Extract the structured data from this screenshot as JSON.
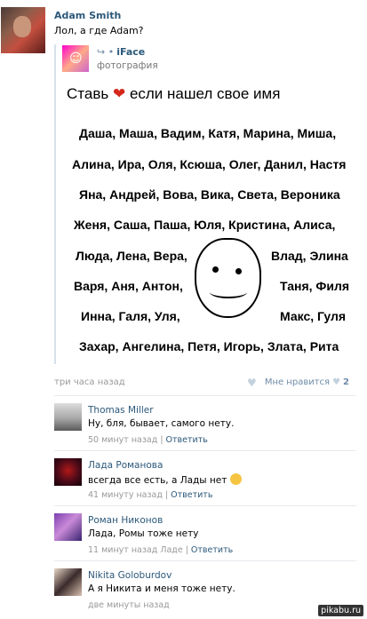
{
  "post": {
    "author": "Adam Smith",
    "text": "Лол, а где Adam?"
  },
  "repost": {
    "source_name": "iFace",
    "source_sub": "фотография"
  },
  "meme": {
    "title_before": "Ставь",
    "title_after": "если нашел свое имя",
    "rows": [
      "Даша, Маша, Вадим, Катя, Марина, Миша,",
      "Алина, Ира, Оля, Ксюша, Олег, Данил, Настя",
      "Яна, Андрей, Вова, Вика, Света, Вероника",
      "Женя, Саша, Паша, Юля, Кристина, Алиса,",
      "Люда, Лена, Вера,",
      "Влад, Элина",
      "Варя, Аня, Антон,",
      "Таня, Филя",
      "Инна, Галя, Уля,",
      "Макс, Гуля",
      "Захар, Ангелина, Петя, Игорь, Злата, Рита"
    ]
  },
  "footer": {
    "time": "три часа назад",
    "like_label": "Мне нравится",
    "like_count": "2"
  },
  "comments": [
    {
      "name": "Thomas Miller",
      "text": "Ну, бля, бывает, самого нету.",
      "time": "50 минут назад",
      "reply": "Ответить"
    },
    {
      "name": "Лада Романова",
      "text": "всегда все есть, а Лады нет",
      "time": "41 минуту назад",
      "reply": "Ответить"
    },
    {
      "name": "Роман Никонов",
      "text": "Лада, Ромы тоже нету",
      "time": "11 минут назад Ладе",
      "reply": "Ответить"
    },
    {
      "name": "Nikita Goloburdov",
      "text": "А я Никита и меня тоже нету.",
      "time": "две минуты назад",
      "reply": ""
    }
  ],
  "watermark": "pikabu.ru"
}
